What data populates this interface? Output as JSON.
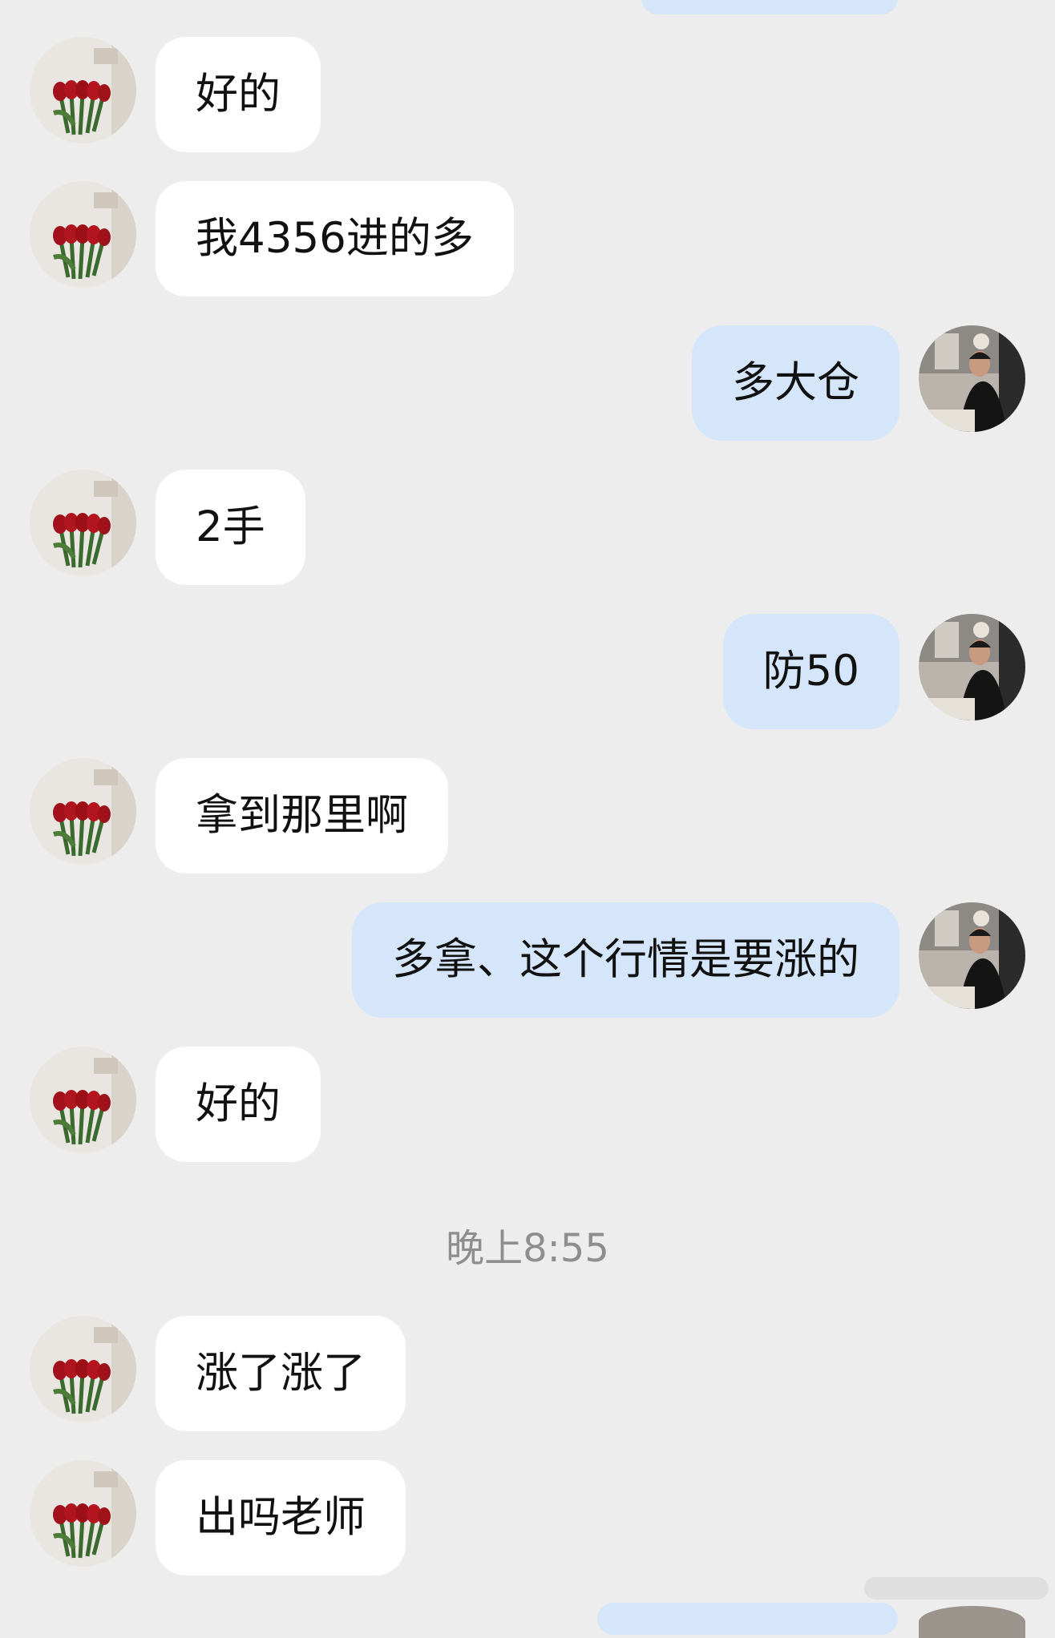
{
  "colors": {
    "background": "#ededed",
    "incoming_bubble": "#ffffff",
    "outgoing_bubble": "#d5e6fb",
    "timestamp_text": "#8e8e8e"
  },
  "icons": {
    "contact_avatar": "tulip-photo-avatar",
    "self_avatar": "man-portrait-avatar"
  },
  "messages": [
    {
      "side": "left",
      "text": "好的"
    },
    {
      "side": "left",
      "text": "我4356进的多"
    },
    {
      "side": "right",
      "text": "多大仓"
    },
    {
      "side": "left",
      "text": "2手"
    },
    {
      "side": "right",
      "text": "防50"
    },
    {
      "side": "left",
      "text": "拿到那里啊"
    },
    {
      "side": "right",
      "text": "多拿、这个行情是要涨的"
    },
    {
      "side": "left",
      "text": "好的"
    },
    {
      "side": "left",
      "text": "涨了涨了"
    },
    {
      "side": "left",
      "text": "出吗老师"
    }
  ],
  "timestamp": "晚上8:55"
}
